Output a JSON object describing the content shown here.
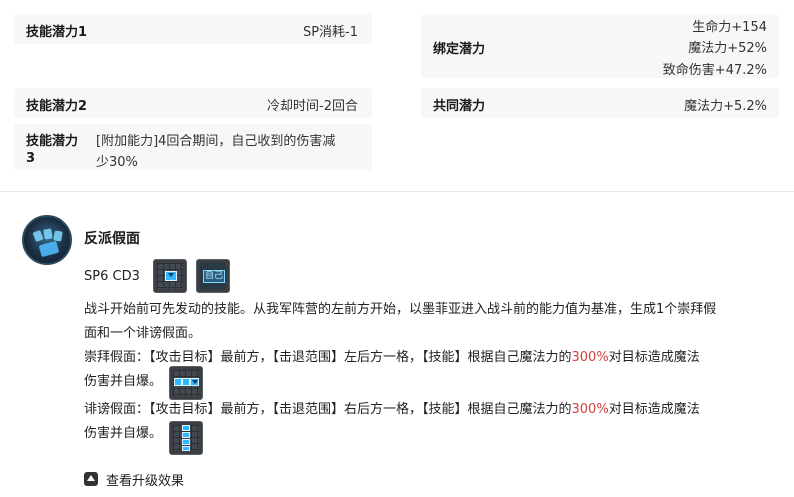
{
  "left_cards": [
    {
      "label": "技能潜力1",
      "value": "SP消耗-1"
    },
    {
      "label": "技能潜力2",
      "value": "冷却时间-2回合"
    },
    {
      "label_line1": "技能潜力",
      "label_line2": "3",
      "value_line1": "[附加能力]4回合期间，自己收到的伤害减",
      "value_line2": "少30%"
    }
  ],
  "right_cards": [
    {
      "label": "绑定潜力",
      "values": [
        "生命力+154",
        "魔法力+52%",
        "致命伤害+47.2%"
      ]
    },
    {
      "label": "共同潜力",
      "value": "魔法力+5.2%"
    }
  ],
  "skill": {
    "name": "反派假面",
    "sp_cd": "SP6  CD3",
    "self_tag": "自己",
    "desc_line1": "战斗开始前可先发动的技能。从我军阵营的左前方开始，以墨菲亚进入战斗前的能力值为基准，生成1个崇拜假",
    "desc_line2": "面和一个诽谤假面。",
    "worship_a": "崇拜假面：【攻击目标】最前方，【击退范围】左后方一格，【技能】根据自己魔法力的",
    "worship_pct": "300%",
    "worship_b": "对目标造成魔法",
    "worship_line2": "伤害并自爆。",
    "slander_a": "诽谤假面：【攻击目标】最前方，【击退范围】右后方一格，【技能】根据自己魔法力的",
    "slander_pct": "300%",
    "slander_b": "对目标造成魔法",
    "slander_line2": "伤害并自爆。"
  },
  "more_label": "查看升级效果",
  "colors": {
    "accent_red": "#d3403b",
    "tile_blue": "#2fb7ff",
    "card_bg": "#f6f7f9"
  }
}
